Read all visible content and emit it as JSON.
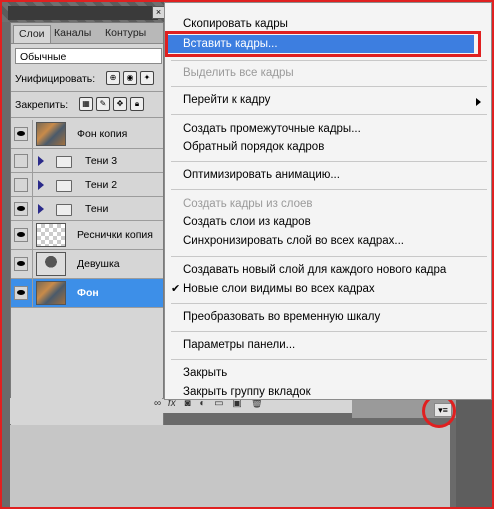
{
  "panel": {
    "tabs": [
      "Слои",
      "Каналы",
      "Контуры"
    ],
    "blend_mode": "Обычные",
    "unify_label": "Унифицировать:",
    "lock_label": "Закрепить:"
  },
  "layers": [
    {
      "name": "Фон копия",
      "visible": true,
      "kind": "photo"
    },
    {
      "name": "Тени 3",
      "visible": false,
      "kind": "group"
    },
    {
      "name": "Тени 2",
      "visible": false,
      "kind": "group"
    },
    {
      "name": "Тени",
      "visible": true,
      "kind": "group"
    },
    {
      "name": "Реснички копия",
      "visible": true,
      "kind": "transparent"
    },
    {
      "name": "Девушка",
      "visible": true,
      "kind": "girl"
    },
    {
      "name": "Фон",
      "visible": true,
      "kind": "photo",
      "selected": true
    }
  ],
  "menu": {
    "copy_frames": "Скопировать кадры",
    "paste_frames": "Вставить кадры...",
    "select_all_frames": "Выделить все кадры",
    "go_to_frame": "Перейти к кадру",
    "tween": "Создать промежуточные кадры...",
    "reverse_frames": "Обратный порядок кадров",
    "optimize": "Оптимизировать анимацию...",
    "frames_from_layers": "Создать кадры из слоев",
    "layers_from_frames": "Создать слои из кадров",
    "match_layer": "Синхронизировать слой во всех кадрах...",
    "new_layer_each_frame": "Создавать новый слой для каждого нового кадра",
    "new_layers_visible": "Новые слои видимы во всех кадрах",
    "convert_timeline": "Преобразовать во временную шкалу",
    "panel_options": "Параметры панели...",
    "close": "Закрыть",
    "close_tab_group": "Закрыть группу вкладок"
  },
  "colors": {
    "highlight": "#3d7ee0",
    "selected_layer": "#3d8fe8",
    "annotation_red": "#e02020"
  }
}
